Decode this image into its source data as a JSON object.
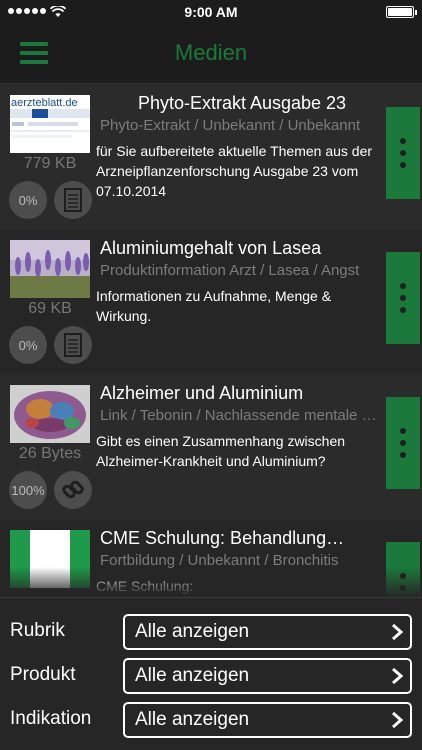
{
  "status_bar": {
    "time": "9:00 AM"
  },
  "nav": {
    "title": "Medien",
    "menu_icon": "hamburger-menu-icon"
  },
  "items": [
    {
      "title": "Phyto-Extrakt Ausgabe 23",
      "meta": "Phyto-Extrakt / Unbekannt / Unbekannt",
      "description": "für Sie aufbereitete aktuelle Themen aus der Arzneipflanzenforschung Ausgabe 23 vom 07.10.2014",
      "size": "779 KB",
      "progress": "0%",
      "type_icon": "document-icon",
      "thumbnail": "aerzteblatt-website-thumbnail",
      "thumb_text": "aerzteblatt.de"
    },
    {
      "title": "Aluminiumgehalt von Lasea",
      "meta": "Produktinformation Arzt / Lasea / Angst",
      "description": "Informationen zu Aufnahme, Menge & Wirkung.",
      "size": "69 KB",
      "progress": "0%",
      "type_icon": "document-icon",
      "thumbnail": "lavender-field-thumbnail"
    },
    {
      "title": "Alzheimer und Aluminium",
      "meta": "Link / Tebonin / Nachlassende mentale Leistung",
      "description": "Gibt es einen Zusammenhang zwischen Alzheimer-Krankheit und Aluminium?",
      "size": "26 Bytes",
      "progress": "100%",
      "type_icon": "link-icon",
      "thumbnail": "brain-scan-thumbnail"
    },
    {
      "title": "CME Schulung: Behandlung…",
      "meta": "Fortbildung / Unbekannt / Bronchitis",
      "description": "CME Schulung:",
      "size": "",
      "progress": "",
      "type_icon": "",
      "thumbnail": "green-white-green-thumbnail"
    }
  ],
  "filters": [
    {
      "label": "Rubrik",
      "value": "Alle anzeigen"
    },
    {
      "label": "Produkt",
      "value": "Alle anzeigen"
    },
    {
      "label": "Indikation",
      "value": "Alle anzeigen"
    }
  ],
  "colors": {
    "accent": "#1b7a3b",
    "background": "#262626",
    "header": "#1c1c1c",
    "muted_text": "#7c7c7c",
    "button_gray": "#4d4d4d"
  }
}
